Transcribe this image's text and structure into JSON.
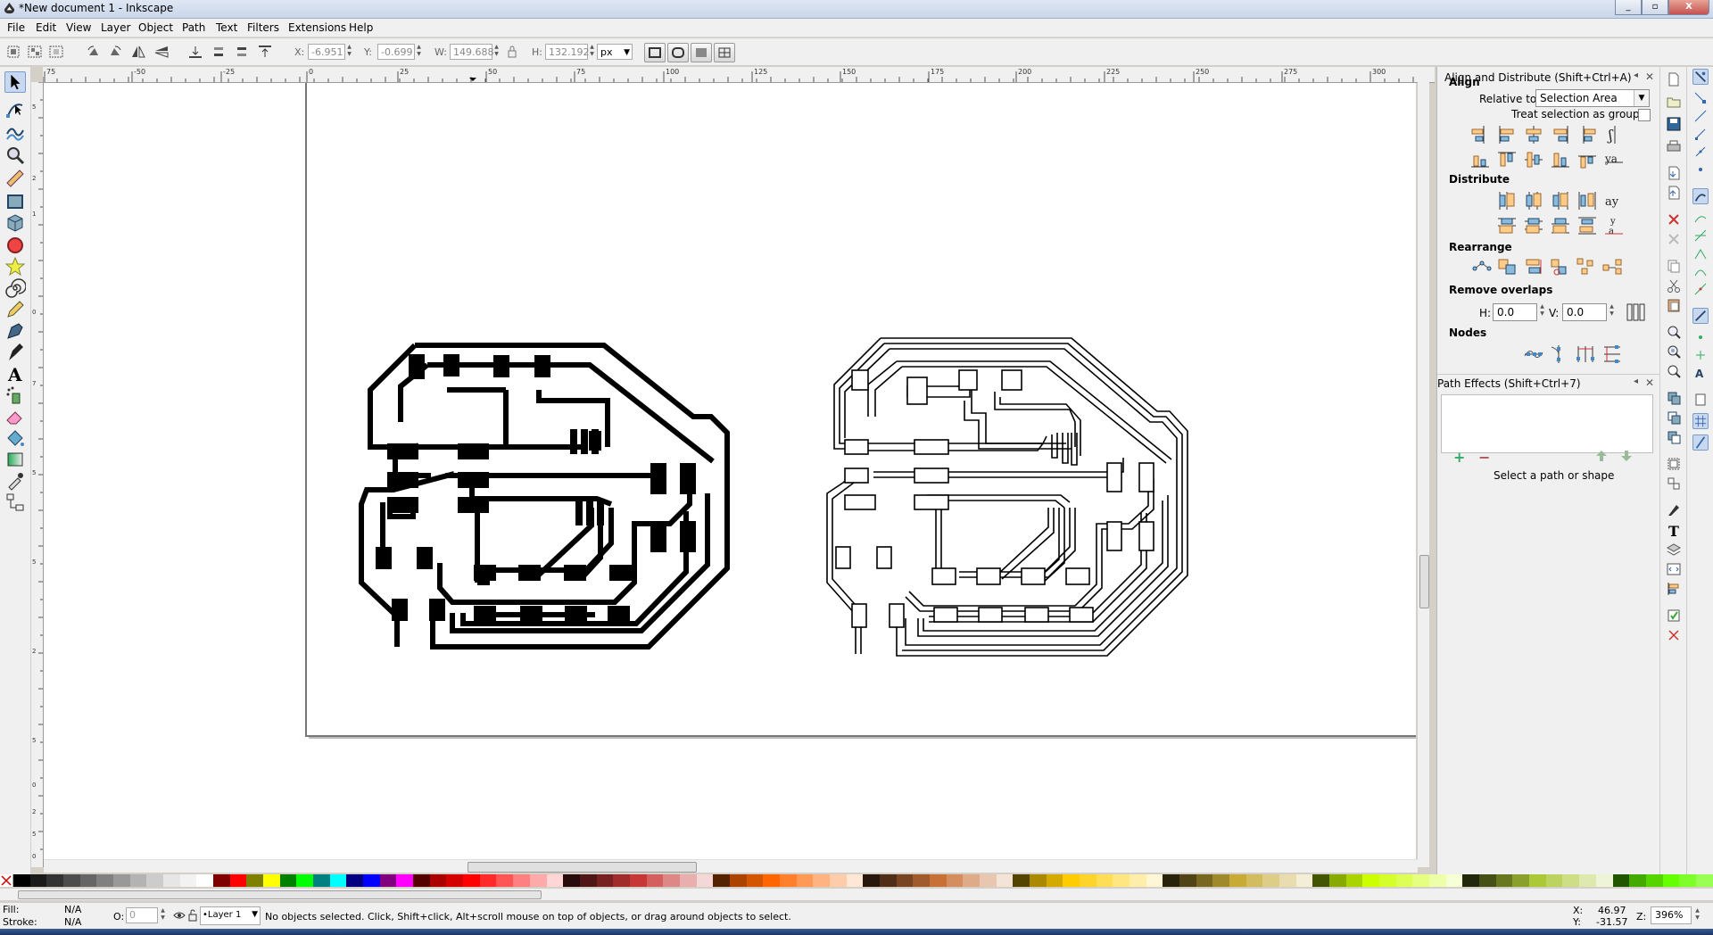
{
  "window": {
    "title": "*New document 1 - Inkscape",
    "minimize": "_",
    "maximize": "▫",
    "close": "X"
  },
  "menu": [
    "File",
    "Edit",
    "View",
    "Layer",
    "Object",
    "Path",
    "Text",
    "Filters",
    "Extensions",
    "Help"
  ],
  "toolbar": {
    "x_label": "X:",
    "x_value": "-6.951",
    "y_label": "Y:",
    "y_value": "-0.699",
    "w_label": "W:",
    "w_value": "149.688",
    "h_label": "H:",
    "h_value": "132.192",
    "unit": "px"
  },
  "ruler_top_ticks": [
    "75",
    "-50",
    "-25",
    "0",
    "25",
    "50",
    "75",
    "100",
    "125",
    "150",
    "175",
    "200",
    "225",
    "250",
    "275",
    "300"
  ],
  "ruler_left_ticks": [
    "5",
    "2",
    "1",
    "0",
    "7",
    "5",
    "5",
    "2",
    "5",
    "0",
    "2",
    "5",
    "0"
  ],
  "align_panel": {
    "title": "Align and Distribute (Shift+Ctrl+A)",
    "align_heading": "Align",
    "relative_label": "Relative to:",
    "relative_value": "Selection Area",
    "treat_group_label": "Treat selection as group:",
    "distribute_heading": "Distribute",
    "rearrange_heading": "Rearrange",
    "remove_overlaps_heading": "Remove overlaps",
    "overlap_h_label": "H:",
    "overlap_h_value": "0.0",
    "overlap_v_label": "V:",
    "overlap_v_value": "0.0",
    "nodes_heading": "Nodes"
  },
  "path_effects_panel": {
    "title": "Path Effects  (Shift+Ctrl+7)",
    "add": "+",
    "remove": "−",
    "message": "Select a path or shape"
  },
  "status": {
    "fill_label": "Fill:",
    "fill_value": "N/A",
    "stroke_label": "Stroke:",
    "stroke_value": "N/A",
    "opacity_label": "O:",
    "opacity_value": "0",
    "layer": "•Layer 1",
    "message": "No objects selected. Click, Shift+click, Alt+scroll mouse on top of objects, or drag around objects to select.",
    "cursor_x_label": "X:",
    "cursor_x": "46.97",
    "cursor_y_label": "Y:",
    "cursor_y": "-31.57",
    "zoom_label": "Z:",
    "zoom": "396%"
  },
  "colors": {
    "accent": "#c8d8f0",
    "canvas": "#ffffff",
    "chrome": "#f0f0f0"
  },
  "palette": [
    "#000000",
    "#1a1a1a",
    "#333333",
    "#4d4d4d",
    "#666666",
    "#808080",
    "#999999",
    "#b3b3b3",
    "#cccccc",
    "#e6e6e6",
    "#f2f2f2",
    "#ffffff",
    "#800000",
    "#ff0000",
    "#808000",
    "#ffff00",
    "#008000",
    "#00ff00",
    "#008080",
    "#00ffff",
    "#000080",
    "#0000ff",
    "#800080",
    "#ff00ff",
    "#550000",
    "#aa0000",
    "#d40000",
    "#ff0000",
    "#ff2a2a",
    "#ff5555",
    "#ff8080",
    "#ffaaaa",
    "#ffd5d5",
    "#280b0b",
    "#501616",
    "#782121",
    "#a02c2c",
    "#c83737",
    "#d35f5f",
    "#de8787",
    "#e9afaf",
    "#f4d7d7",
    "#552200",
    "#aa4400",
    "#d45500",
    "#ff6600",
    "#ff7f2a",
    "#ff9955",
    "#ffb380",
    "#ffccaa",
    "#ffe6d5",
    "#28170b",
    "#502d16",
    "#784421",
    "#a05a2c",
    "#c87137",
    "#d38d5f",
    "#deaa87",
    "#e9c6af",
    "#f4e3d7",
    "#554400",
    "#aa8800",
    "#d4aa00",
    "#ffcc00",
    "#ffd42a",
    "#ffdd55",
    "#ffe680",
    "#ffeeaa",
    "#fff6d5",
    "#28220b",
    "#504416",
    "#786721",
    "#a0892c",
    "#c8ab37",
    "#d3bc5f",
    "#decd87",
    "#e9ddaf",
    "#f4eed7",
    "#445500",
    "#88aa00",
    "#aad400",
    "#ccff00",
    "#d4ff2a",
    "#ddff55",
    "#e5ff80",
    "#eeffaa",
    "#f6ffd5",
    "#22280b",
    "#445016",
    "#677821",
    "#89a02c",
    "#abc837",
    "#bcd35f",
    "#cdde87",
    "#dde9af",
    "#eef4d7",
    "#225500",
    "#44aa00",
    "#55d400",
    "#66ff00",
    "#7fff2a",
    "#99ff55"
  ]
}
